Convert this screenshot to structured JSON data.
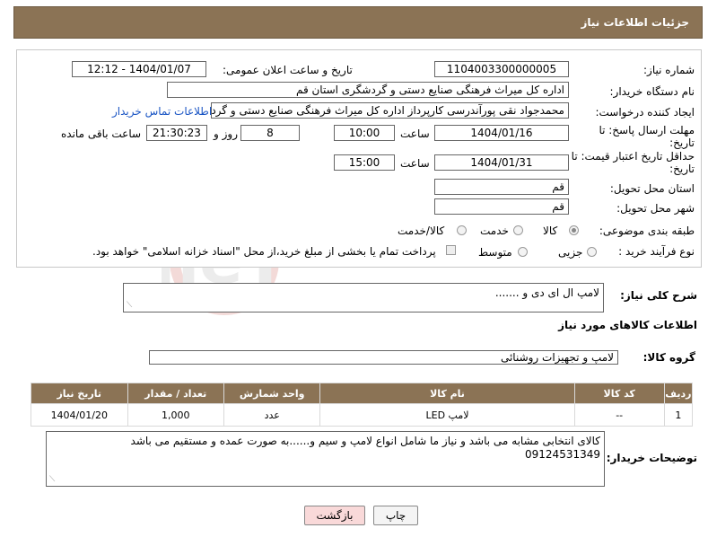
{
  "header": {
    "title": "جزئیات اطلاعات نیاز"
  },
  "form": {
    "need_number_label": "شماره نیاز:",
    "need_number": "1104003300000005",
    "announce_label": "تاریخ و ساعت اعلان عمومی:",
    "announce_value": "1404/01/07 - 12:12",
    "buyer_org_label": "نام دستگاه خریدار:",
    "buyer_org": "اداره کل میراث فرهنگی  صنایع دستی و گردشگری استان قم",
    "creator_label": "ایجاد کننده درخواست:",
    "creator": "محمدجواد نقی پورآندرسی کارپرداز اداره کل میراث فرهنگی  صنایع دستی و گردشگری",
    "contact_link": "اطلاعات تماس خریدار",
    "deadline_label_1": "مهلت ارسال پاسخ: تا",
    "deadline_label_2": "تاریخ:",
    "deadline_date": "1404/01/16",
    "time_label": "ساعت",
    "deadline_time": "10:00",
    "days": "8",
    "days_label": "روز و",
    "remaining_time": "21:30:23",
    "remaining_label": "ساعت باقی مانده",
    "validity_label_1": "حداقل تاریخ اعتبار قیمت: تا",
    "validity_label_2": "تاریخ:",
    "validity_date": "1404/01/31",
    "validity_time": "15:00",
    "province_label": "استان محل تحویل:",
    "province": "قم",
    "city_label": "شهر محل تحویل:",
    "city": "قم",
    "category_label": "طبقه بندی موضوعی:",
    "category_options": [
      "کالا",
      "خدمت",
      "کالا/خدمت"
    ],
    "category_selected": "کالا",
    "process_label": "نوع فرآیند خرید :",
    "process_options": [
      "جزیی",
      "متوسط"
    ],
    "payment_note": "پرداخت تمام یا بخشی از مبلغ خرید،از محل \"اسناد خزانه اسلامی\" خواهد بود."
  },
  "description": {
    "label": "شرح کلی نیاز:",
    "value": "لامپ ال ای دی و ......."
  },
  "goods": {
    "section_title": "اطلاعات کالاهای مورد نیاز",
    "group_label": "گروه کالا:",
    "group_value": "لامپ و تجهیزات روشنائی",
    "columns": [
      "ردیف",
      "کد کالا",
      "نام کالا",
      "واحد شمارش",
      "تعداد / مقدار",
      "تاریخ نیاز"
    ],
    "rows": [
      [
        "1",
        "--",
        "لامپ LED",
        "عدد",
        "1,000",
        "1404/01/20"
      ]
    ]
  },
  "buyer_notes": {
    "label": "توضیحات خریدار:",
    "line1": "کالای انتخابی مشابه می باشد و نیاز ما شامل انواع لامپ و سیم و......به صورت عمده و مستقیم  می باشد",
    "line2": "09124531349"
  },
  "buttons": {
    "print": "چاپ",
    "back": "بازگشت"
  },
  "colors": {
    "header_bg": "#8b7355",
    "link": "#1a55c4",
    "back_bg": "#f9d9d9"
  },
  "icons": {
    "watermark": "ariatender-logo"
  }
}
